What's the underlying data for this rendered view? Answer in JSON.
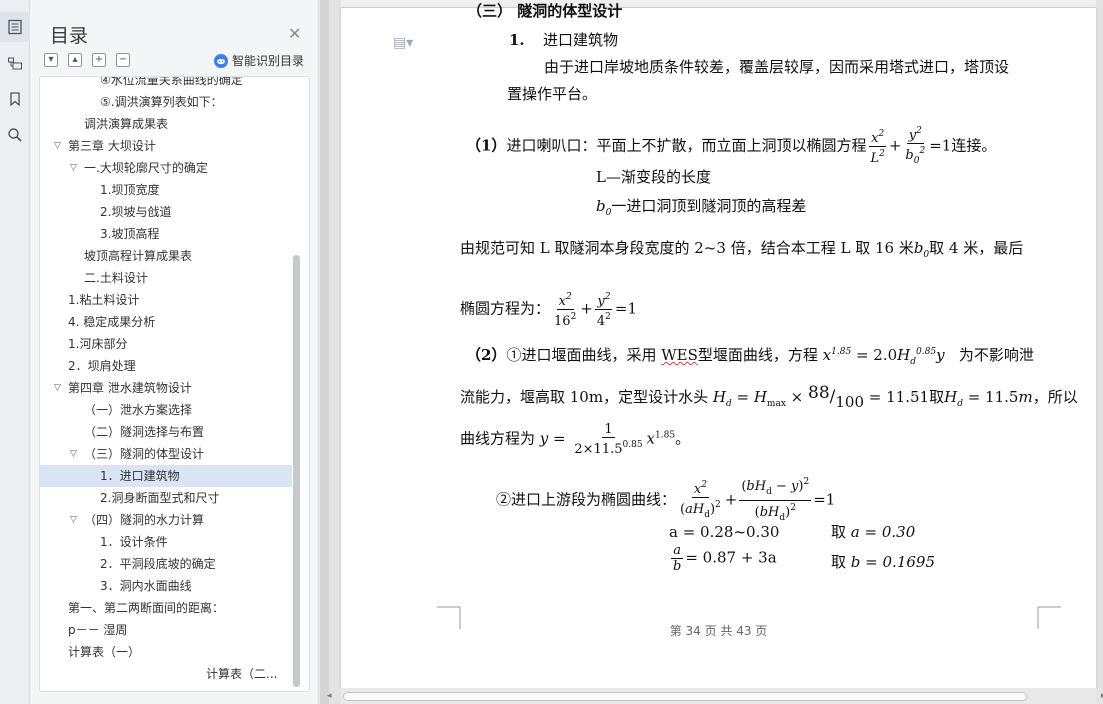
{
  "toc": {
    "title": "目录",
    "smart_label": "智能识别目录",
    "items": [
      {
        "label": "④水位流量关系曲线的确定",
        "indent": 60
      },
      {
        "label": "⑤.调洪演算列表如下：",
        "indent": 60
      },
      {
        "label": "调洪演算成果表",
        "indent": 44
      },
      {
        "label": "第三章    大坝设计",
        "indent": 28,
        "arrow": "expanded"
      },
      {
        "label": "一.大坝轮廓尺寸的确定",
        "indent": 44,
        "arrow": "expanded"
      },
      {
        "label": "1.坝顶宽度",
        "indent": 60
      },
      {
        "label": "2.坝坡与戗道",
        "indent": 60
      },
      {
        "label": "3.坡顶高程",
        "indent": 60
      },
      {
        "label": "坡顶高程计算成果表",
        "indent": 44
      },
      {
        "label": "二.土料设计",
        "indent": 44
      },
      {
        "label": "1.粘土料设计",
        "indent": 28
      },
      {
        "label": "4.    稳定成果分析",
        "indent": 28
      },
      {
        "label": "1.河床部分",
        "indent": 28
      },
      {
        "label": "2．坝肩处理",
        "indent": 28
      },
      {
        "label": "第四章      泄水建筑物设计",
        "indent": 28,
        "arrow": "expanded"
      },
      {
        "label": "（一）泄水方案选择",
        "indent": 44
      },
      {
        "label": "（二）隧洞选择与布置",
        "indent": 44
      },
      {
        "label": "（三）隧洞的体型设计",
        "indent": 44,
        "arrow": "expanded"
      },
      {
        "label": "1．进口建筑物",
        "indent": 60,
        "selected": true
      },
      {
        "label": "2.洞身断面型式和尺寸",
        "indent": 60
      },
      {
        "label": "（四）隧洞的水力计算",
        "indent": 44,
        "arrow": "expanded"
      },
      {
        "label": "1．设计条件",
        "indent": 60
      },
      {
        "label": "2．平洞段底坡的确定",
        "indent": 60
      },
      {
        "label": "3．洞内水面曲线",
        "indent": 60
      },
      {
        "label": "第一、第二两断面间的距离：",
        "indent": 28
      },
      {
        "label": "p－－  湿周",
        "indent": 28
      },
      {
        "label": "计算表（一）",
        "indent": 28
      },
      {
        "label": "计算表（二...",
        "indent": 166
      }
    ]
  },
  "doc": {
    "heading_partial": "（三） 隧洞的体型设计",
    "sub1": "1.",
    "sub1_title": "进口建筑物",
    "para1a": "由于进口岸坡地质条件较差，覆盖层较厚，因而采用塔式进口，塔顶设",
    "para1b": "置操作平台。",
    "item1_label": "（1）",
    "item1_text": "进口喇叭口：平面上不扩散，而立面上洞顶以椭圆方程",
    "item1_tail": "连接。",
    "def_L": "L—渐变段的长度",
    "def_b0": "一进口洞顶到隧洞顶的高程差",
    "para2_a": "由规范可知 L 取隧洞本身段宽度的 2~3 倍，结合本工程 L 取 16 米",
    "para2_b": "取 4 米，最后",
    "ellipse_label": "椭圆方程为：",
    "item2_label": "（2）",
    "item2_text_a": "①进口堰面曲线，采用",
    "wes": "WES",
    "item2_text_b": "型堰面曲线，方程",
    "item2_text_c": "为不影响泄",
    "flow_a": "流能力，堰高取 10m，定型设计水头",
    "flow_b": "取",
    "flow_c": "，所以",
    "curve_label": "曲线方程为",
    "upstream_label": "②进口上游段为椭圆曲线：",
    "a_range": "a = 0.28~0.30",
    "a_take": "取",
    "a_val": "a = 0.30",
    "ab_eq": "= 0.87 + 3a",
    "b_take": "取",
    "b_val": "b = 0.1695",
    "footer": "第 34 页 共 43 页"
  }
}
